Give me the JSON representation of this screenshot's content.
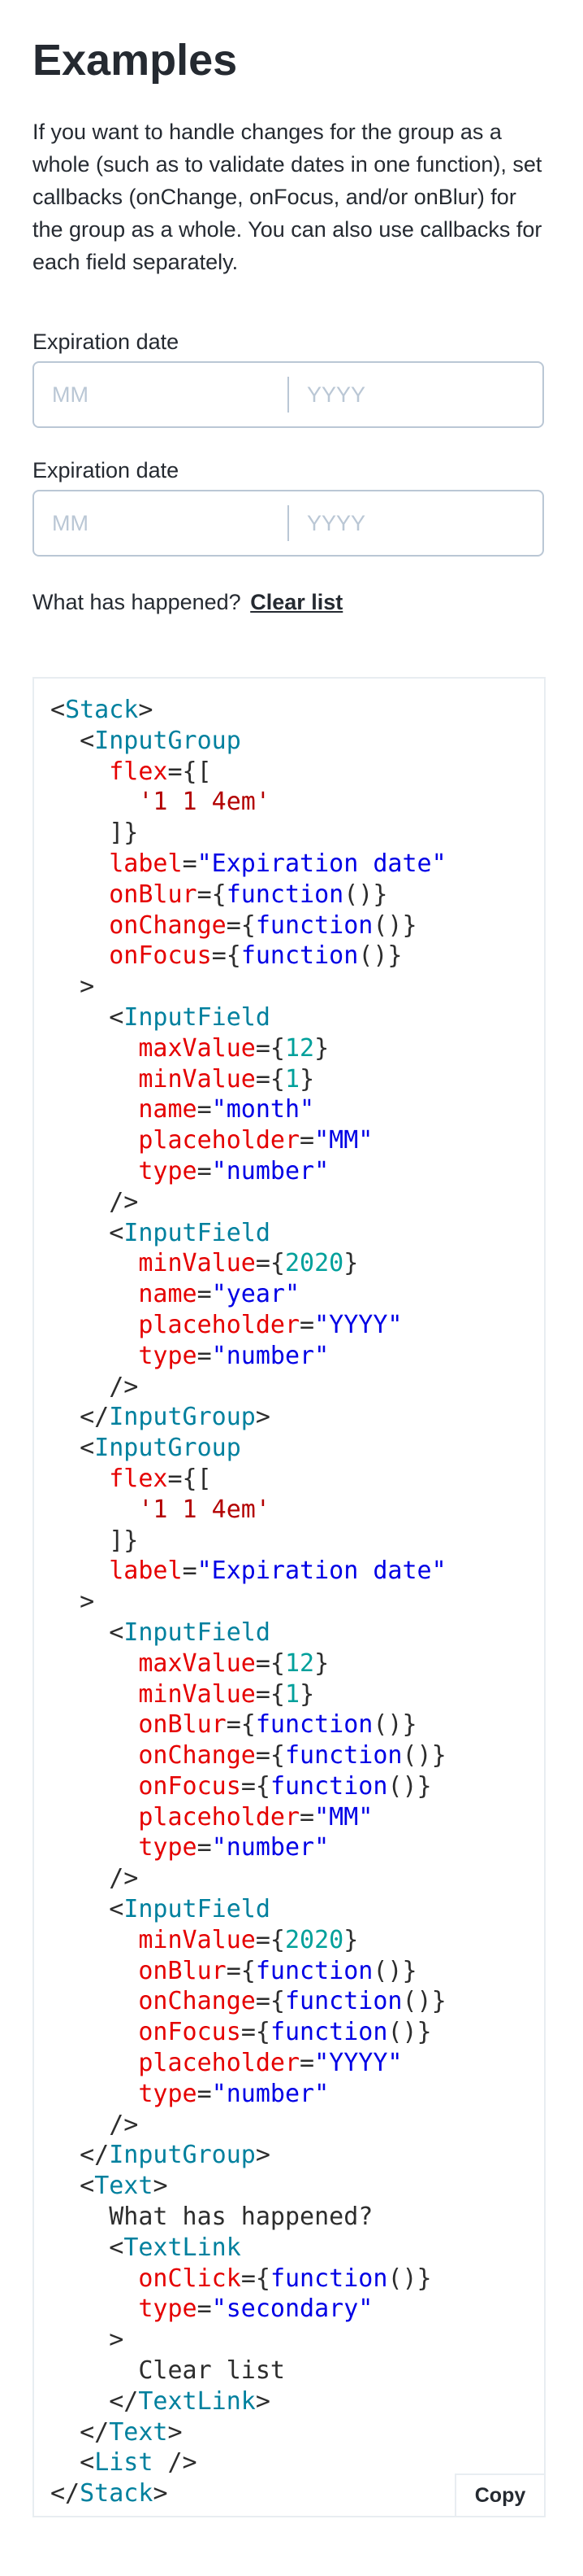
{
  "heading": "Examples",
  "intro": "If you want to handle changes for the group as a whole (such as to validate dates in one function), set callbacks (onChange, onFocus, and/or onBlur) for the group as a whole. You can also use callbacks for each field separately.",
  "groups": [
    {
      "label": "Expiration date",
      "month_placeholder": "MM",
      "year_placeholder": "YYYY"
    },
    {
      "label": "Expiration date",
      "month_placeholder": "MM",
      "year_placeholder": "YYYY"
    }
  ],
  "status": {
    "text": "What has happened?",
    "link": "Clear list"
  },
  "code": {
    "lines": [
      [
        [
          "p",
          "<"
        ],
        [
          "t",
          "Stack"
        ],
        [
          "p",
          ">"
        ]
      ],
      [
        [
          "p",
          "  <"
        ],
        [
          "t",
          "InputGroup"
        ]
      ],
      [
        [
          "a",
          "    flex"
        ],
        [
          "p",
          "={["
        ]
      ],
      [
        [
          "d",
          "      '1 1 4em'"
        ]
      ],
      [
        [
          "p",
          "    ]}"
        ]
      ],
      [
        [
          "a",
          "    label"
        ],
        [
          "p",
          "="
        ],
        [
          "s",
          "\"Expiration date\""
        ]
      ],
      [
        [
          "a",
          "    onBlur"
        ],
        [
          "p",
          "={"
        ],
        [
          "s",
          "function"
        ],
        [
          "p",
          "()}"
        ]
      ],
      [
        [
          "a",
          "    onChange"
        ],
        [
          "p",
          "={"
        ],
        [
          "s",
          "function"
        ],
        [
          "p",
          "()}"
        ]
      ],
      [
        [
          "a",
          "    onFocus"
        ],
        [
          "p",
          "={"
        ],
        [
          "s",
          "function"
        ],
        [
          "p",
          "()}"
        ]
      ],
      [
        [
          "p",
          "  >"
        ]
      ],
      [
        [
          "p",
          "    <"
        ],
        [
          "t",
          "InputField"
        ]
      ],
      [
        [
          "a",
          "      maxValue"
        ],
        [
          "p",
          "={"
        ],
        [
          "n",
          "12"
        ],
        [
          "p",
          "}"
        ]
      ],
      [
        [
          "a",
          "      minValue"
        ],
        [
          "p",
          "={"
        ],
        [
          "n",
          "1"
        ],
        [
          "p",
          "}"
        ]
      ],
      [
        [
          "a",
          "      name"
        ],
        [
          "p",
          "="
        ],
        [
          "s",
          "\"month\""
        ]
      ],
      [
        [
          "a",
          "      placeholder"
        ],
        [
          "p",
          "="
        ],
        [
          "s",
          "\"MM\""
        ]
      ],
      [
        [
          "a",
          "      type"
        ],
        [
          "p",
          "="
        ],
        [
          "s",
          "\"number\""
        ]
      ],
      [
        [
          "p",
          "    />"
        ]
      ],
      [
        [
          "p",
          "    <"
        ],
        [
          "t",
          "InputField"
        ]
      ],
      [
        [
          "a",
          "      minValue"
        ],
        [
          "p",
          "={"
        ],
        [
          "n",
          "2020"
        ],
        [
          "p",
          "}"
        ]
      ],
      [
        [
          "a",
          "      name"
        ],
        [
          "p",
          "="
        ],
        [
          "s",
          "\"year\""
        ]
      ],
      [
        [
          "a",
          "      placeholder"
        ],
        [
          "p",
          "="
        ],
        [
          "s",
          "\"YYYY\""
        ]
      ],
      [
        [
          "a",
          "      type"
        ],
        [
          "p",
          "="
        ],
        [
          "s",
          "\"number\""
        ]
      ],
      [
        [
          "p",
          "    />"
        ]
      ],
      [
        [
          "p",
          "  </"
        ],
        [
          "t",
          "InputGroup"
        ],
        [
          "p",
          ">"
        ]
      ],
      [
        [
          "p",
          "  <"
        ],
        [
          "t",
          "InputGroup"
        ]
      ],
      [
        [
          "a",
          "    flex"
        ],
        [
          "p",
          "={["
        ]
      ],
      [
        [
          "d",
          "      '1 1 4em'"
        ]
      ],
      [
        [
          "p",
          "    ]}"
        ]
      ],
      [
        [
          "a",
          "    label"
        ],
        [
          "p",
          "="
        ],
        [
          "s",
          "\"Expiration date\""
        ]
      ],
      [
        [
          "p",
          "  >"
        ]
      ],
      [
        [
          "p",
          "    <"
        ],
        [
          "t",
          "InputField"
        ]
      ],
      [
        [
          "a",
          "      maxValue"
        ],
        [
          "p",
          "={"
        ],
        [
          "n",
          "12"
        ],
        [
          "p",
          "}"
        ]
      ],
      [
        [
          "a",
          "      minValue"
        ],
        [
          "p",
          "={"
        ],
        [
          "n",
          "1"
        ],
        [
          "p",
          "}"
        ]
      ],
      [
        [
          "a",
          "      onBlur"
        ],
        [
          "p",
          "={"
        ],
        [
          "s",
          "function"
        ],
        [
          "p",
          "()}"
        ]
      ],
      [
        [
          "a",
          "      onChange"
        ],
        [
          "p",
          "={"
        ],
        [
          "s",
          "function"
        ],
        [
          "p",
          "()}"
        ]
      ],
      [
        [
          "a",
          "      onFocus"
        ],
        [
          "p",
          "={"
        ],
        [
          "s",
          "function"
        ],
        [
          "p",
          "()}"
        ]
      ],
      [
        [
          "a",
          "      placeholder"
        ],
        [
          "p",
          "="
        ],
        [
          "s",
          "\"MM\""
        ]
      ],
      [
        [
          "a",
          "      type"
        ],
        [
          "p",
          "="
        ],
        [
          "s",
          "\"number\""
        ]
      ],
      [
        [
          "p",
          "    />"
        ]
      ],
      [
        [
          "p",
          "    <"
        ],
        [
          "t",
          "InputField"
        ]
      ],
      [
        [
          "a",
          "      minValue"
        ],
        [
          "p",
          "={"
        ],
        [
          "n",
          "2020"
        ],
        [
          "p",
          "}"
        ]
      ],
      [
        [
          "a",
          "      onBlur"
        ],
        [
          "p",
          "={"
        ],
        [
          "s",
          "function"
        ],
        [
          "p",
          "()}"
        ]
      ],
      [
        [
          "a",
          "      onChange"
        ],
        [
          "p",
          "={"
        ],
        [
          "s",
          "function"
        ],
        [
          "p",
          "()}"
        ]
      ],
      [
        [
          "a",
          "      onFocus"
        ],
        [
          "p",
          "={"
        ],
        [
          "s",
          "function"
        ],
        [
          "p",
          "()}"
        ]
      ],
      [
        [
          "a",
          "      placeholder"
        ],
        [
          "p",
          "="
        ],
        [
          "s",
          "\"YYYY\""
        ]
      ],
      [
        [
          "a",
          "      type"
        ],
        [
          "p",
          "="
        ],
        [
          "s",
          "\"number\""
        ]
      ],
      [
        [
          "p",
          "    />"
        ]
      ],
      [
        [
          "p",
          "  </"
        ],
        [
          "t",
          "InputGroup"
        ],
        [
          "p",
          ">"
        ]
      ],
      [
        [
          "p",
          "  <"
        ],
        [
          "t",
          "Text"
        ],
        [
          "p",
          ">"
        ]
      ],
      [
        [
          "p",
          "    What has happened?"
        ]
      ],
      [
        [
          "p",
          "    <"
        ],
        [
          "t",
          "TextLink"
        ]
      ],
      [
        [
          "a",
          "      onClick"
        ],
        [
          "p",
          "={"
        ],
        [
          "s",
          "function"
        ],
        [
          "p",
          "()}"
        ]
      ],
      [
        [
          "a",
          "      type"
        ],
        [
          "p",
          "="
        ],
        [
          "s",
          "\"secondary\""
        ]
      ],
      [
        [
          "p",
          "    >"
        ]
      ],
      [
        [
          "p",
          "      Clear list"
        ]
      ],
      [
        [
          "p",
          "    </"
        ],
        [
          "t",
          "TextLink"
        ],
        [
          "p",
          ">"
        ]
      ],
      [
        [
          "p",
          "  </"
        ],
        [
          "t",
          "Text"
        ],
        [
          "p",
          ">"
        ]
      ],
      [
        [
          "p",
          "  <"
        ],
        [
          "t",
          "List"
        ],
        [
          "p",
          " />"
        ]
      ],
      [
        [
          "p",
          "</"
        ],
        [
          "t",
          "Stack"
        ],
        [
          "p",
          ">"
        ]
      ]
    ],
    "copy_label": "Copy"
  },
  "colors": {
    "text": "#252a31",
    "border": "#bac7d5",
    "placeholder": "#bac7d5",
    "code_tag": "#00809e",
    "code_attr": "#e50000",
    "code_string": "#0000e5",
    "code_number": "#00a09b",
    "code_literal": "#b30000"
  }
}
